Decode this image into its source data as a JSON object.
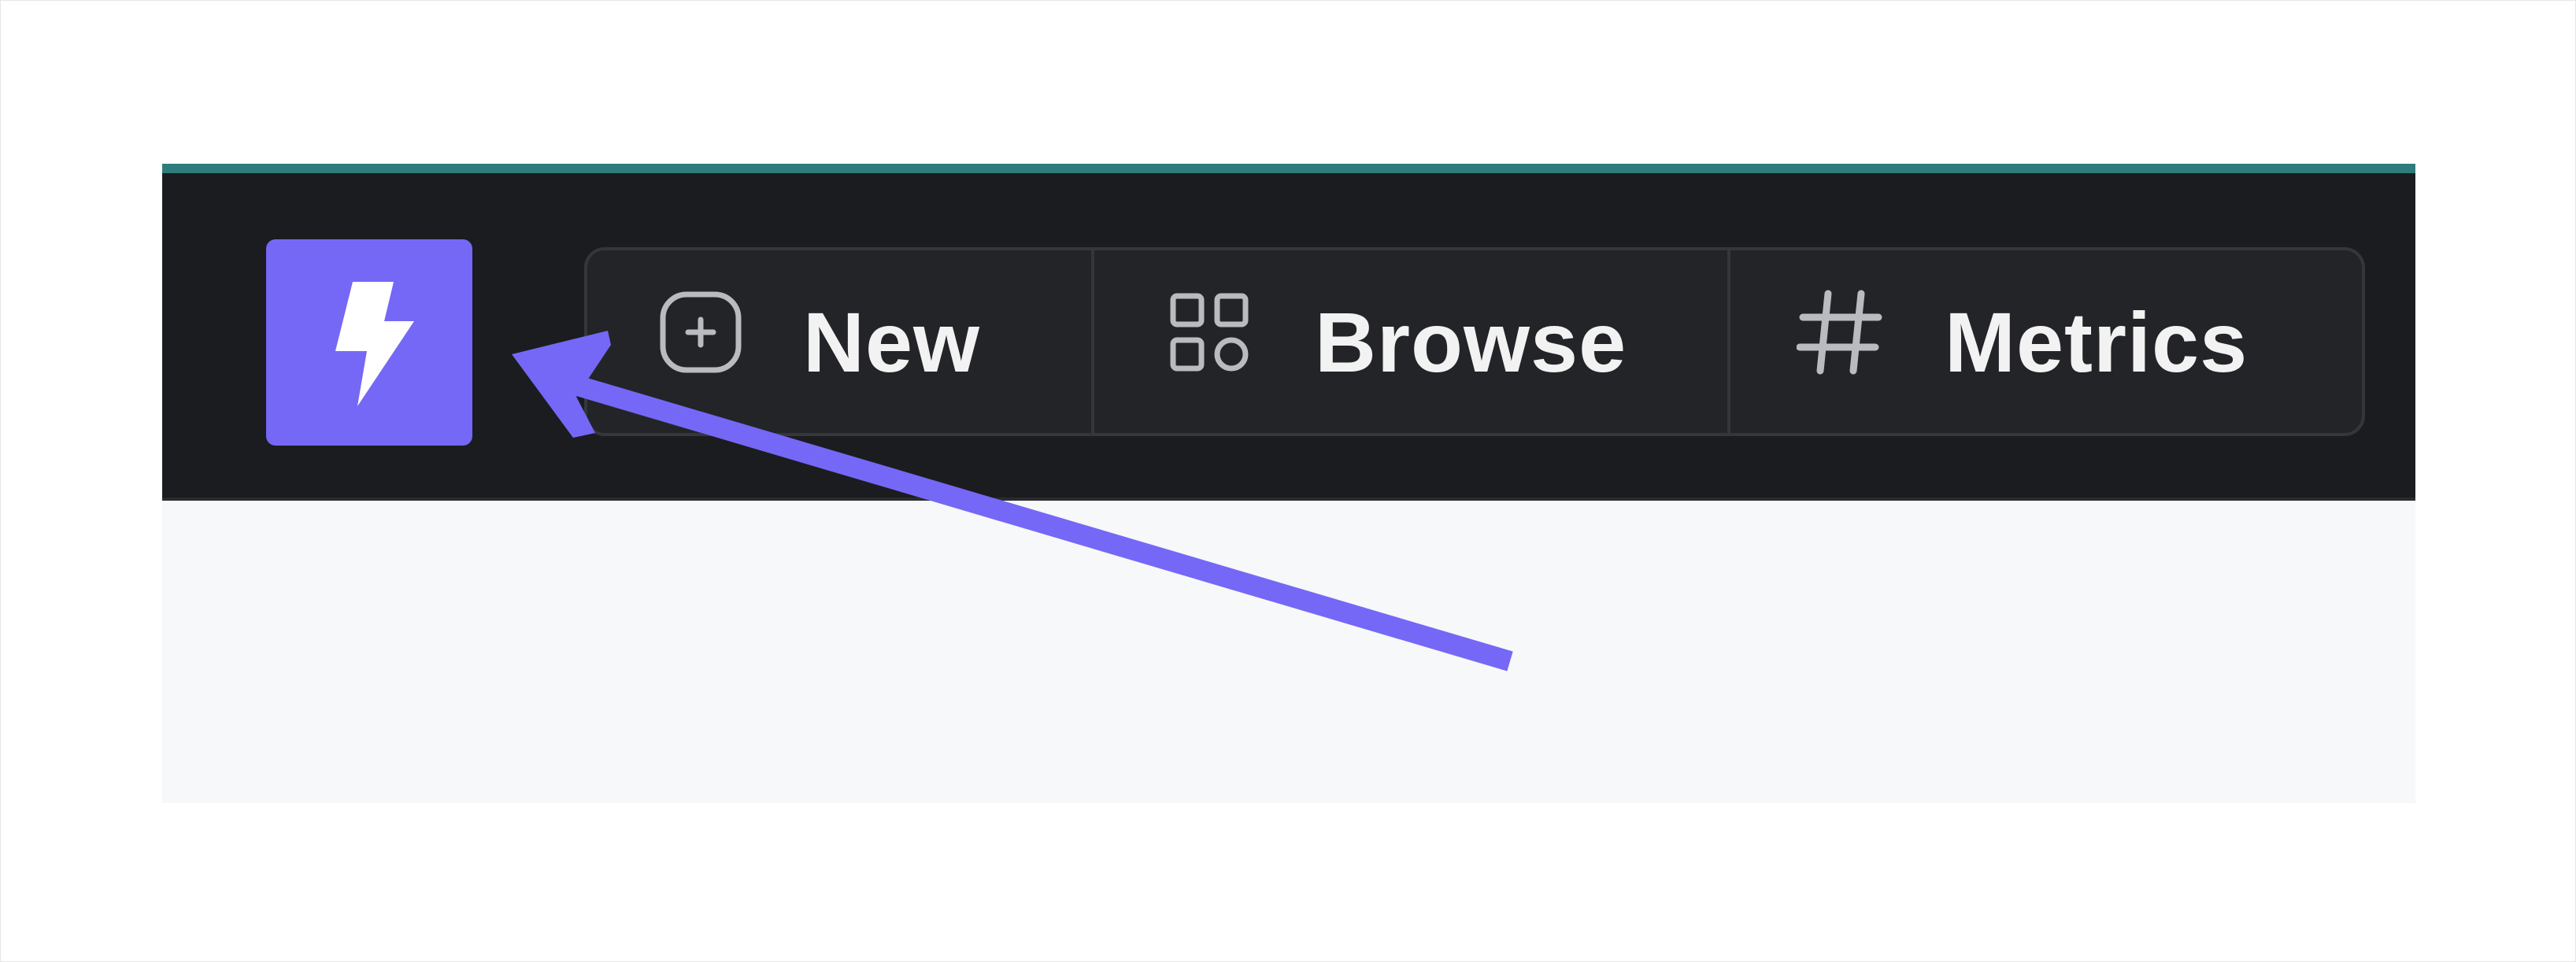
{
  "toolbar": {
    "logo_icon": "lightning-bolt-icon",
    "items": [
      {
        "label": "New",
        "icon": "plus-square-icon"
      },
      {
        "label": "Browse",
        "icon": "grid-icon"
      },
      {
        "label": "Metrics",
        "icon": "hash-icon"
      }
    ]
  },
  "annotation": {
    "icon": "arrow-icon"
  },
  "colors": {
    "accent": "#7568f6",
    "topline": "#2f7c7c",
    "navbar": "#1b1c1f",
    "content": "#f7f8f9"
  }
}
